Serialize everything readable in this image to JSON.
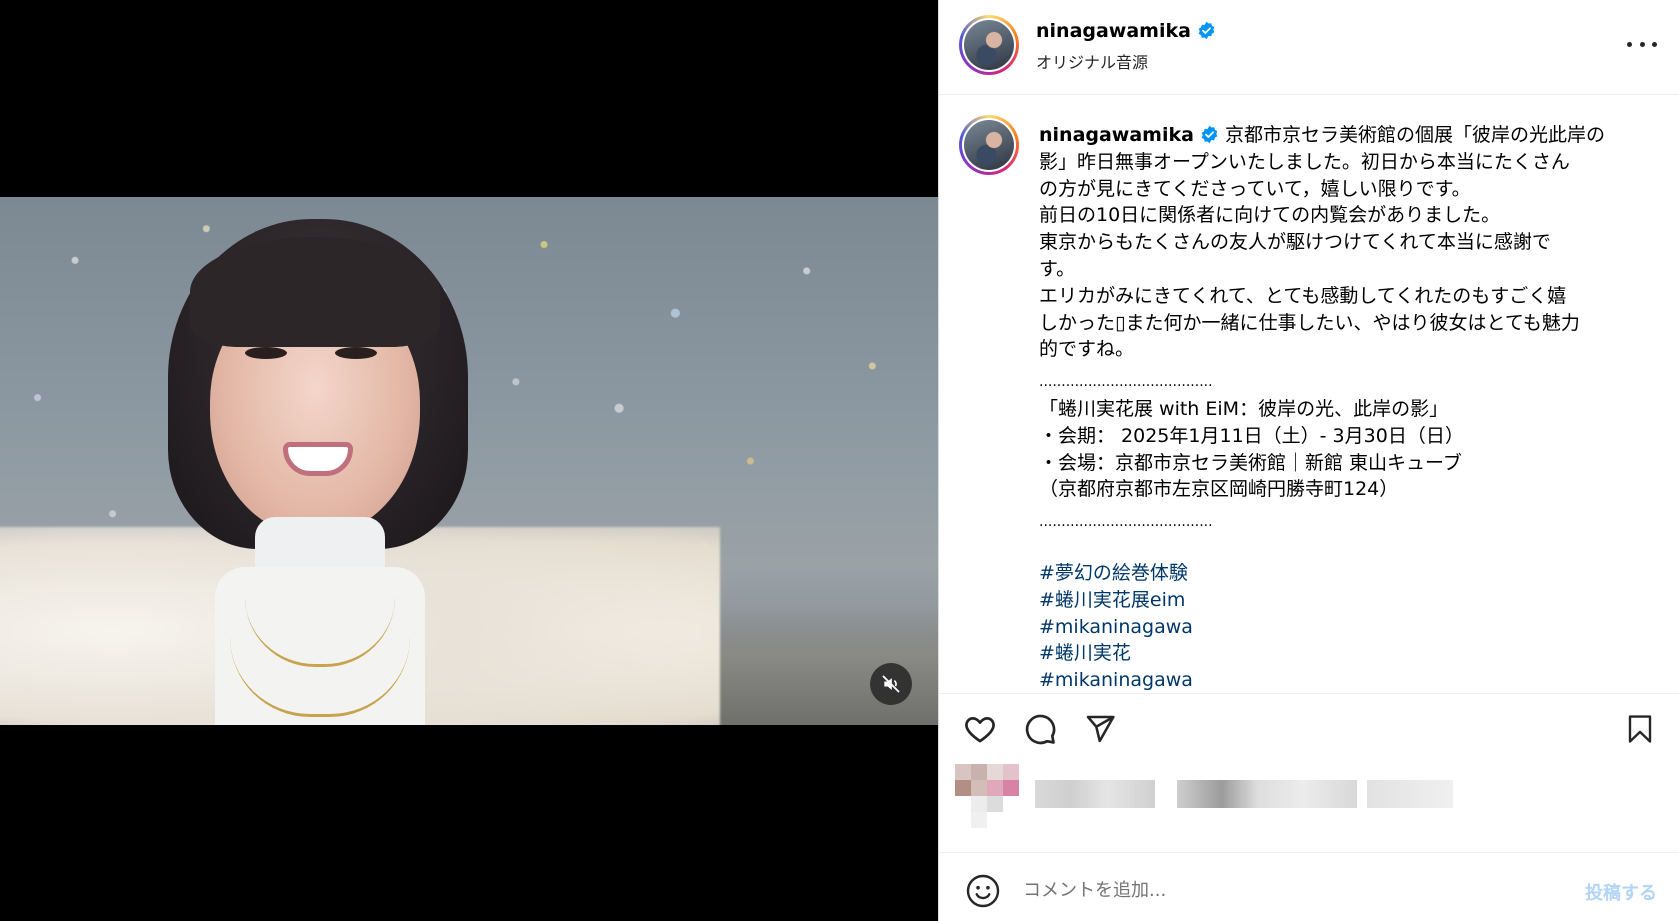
{
  "post": {
    "username": "ninagawamika",
    "audio": "オリジナル音源"
  },
  "caption": {
    "username": "ninagawamika",
    "lines": [
      "京都市京セラ美術館の個展「彼岸の光此岸の",
      "影」昨日無事オープンいたしました。初日から本当にたくさん",
      "の方が見にきてくださっていて，嬉しい限りです。",
      "前日の10日に関係者に向けての内覧会がありました。",
      "東京からもたくさんの友人が駆けつけてくれて本当に感謝で",
      "す。",
      "エリカがみにきてくれて、とても感動してくれたのもすごく嬉",
      "しかった▯また何か一緒に仕事したい、やはり彼女はとても魅力",
      "的ですね。"
    ],
    "separator": ".......................................",
    "exhibition": [
      "「蜷川実花展 with EiM：彼岸の光、此岸の影」",
      "・会期： 2025年1月11日（土）- 3月30日（日）",
      "・会場：京都市京セラ美術館｜新館 東山キューブ",
      "（京都府京都市左京区岡崎円勝寺町124）"
    ],
    "hashtags": [
      "#夢幻の絵巻体験",
      "#蜷川実花展eim",
      "#mikaninagawa",
      "#蜷川実花",
      "#mikaninagawa"
    ]
  },
  "comment": {
    "placeholder": "コメントを追加...",
    "post_label": "投稿する"
  },
  "icons": {
    "like": "heart-icon",
    "comment": "comment-icon",
    "share": "share-icon",
    "save": "bookmark-icon",
    "more": "more-icon",
    "mute": "muted-speaker-icon",
    "emoji": "emoji-icon",
    "verified": "verified-badge-icon"
  },
  "colors": {
    "verified": "#0095f6",
    "hashtag": "#00376b",
    "post_button": "#b3d4f5"
  }
}
